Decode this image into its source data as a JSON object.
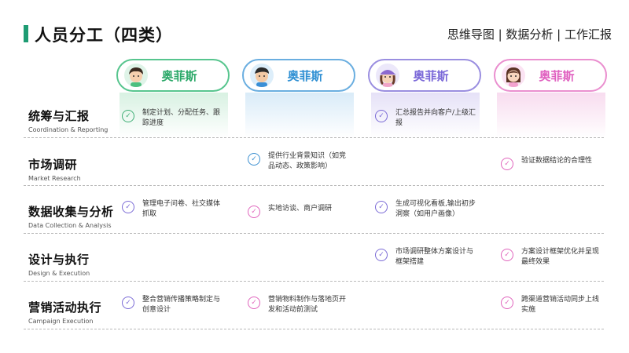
{
  "header": {
    "title": "人员分工（四类）",
    "subtitle": "思维导图 | 数据分析 | 工作汇报",
    "accent_color": "#1e9c73"
  },
  "personas": [
    {
      "name": "奥菲斯",
      "color": "#2aa868",
      "avatar": "avatar-boy-icon"
    },
    {
      "name": "奥菲斯",
      "color": "#2e8fd3",
      "avatar": "avatar-man-icon"
    },
    {
      "name": "奥菲斯",
      "color": "#7a68d8",
      "avatar": "avatar-girl-cap-icon"
    },
    {
      "name": "奥菲斯",
      "color": "#e061c0",
      "avatar": "avatar-girl-icon"
    }
  ],
  "rows": [
    {
      "cn": "统筹与汇报",
      "en": "Coordination & Reporting",
      "tasks": [
        "制定计划、分配任务、跟踪进度",
        "",
        "汇总报告并向客户/上级汇报",
        ""
      ]
    },
    {
      "cn": "市场调研",
      "en": "Market Research",
      "tasks": [
        "",
        "提供行业背景知识（如竞品动态、政策影响）",
        "",
        "验证数据结论的合理性"
      ]
    },
    {
      "cn": "数据收集与分析",
      "en": "Data Collection & Analysis",
      "tasks": [
        "管理电子问卷、社交媒体抓取",
        "实地访谈、商户调研",
        "生成可视化看板,输出初步洞察（如用户画像）",
        ""
      ]
    },
    {
      "cn": "设计与执行",
      "en": "Design & Execution",
      "tasks": [
        "",
        "",
        "市场调研整体方案设计与框架搭建",
        "方案设计框架优化并呈现最终效果"
      ]
    },
    {
      "cn": "营销活动执行",
      "en": "Campaign Execution",
      "tasks": [
        "整合营销传播策略制定与创意设计",
        "营销物料制作与落地页开发和活动前测试",
        "",
        "跨渠道营销活动同步上线实施"
      ]
    }
  ],
  "check_icon": "check-circle-icon"
}
